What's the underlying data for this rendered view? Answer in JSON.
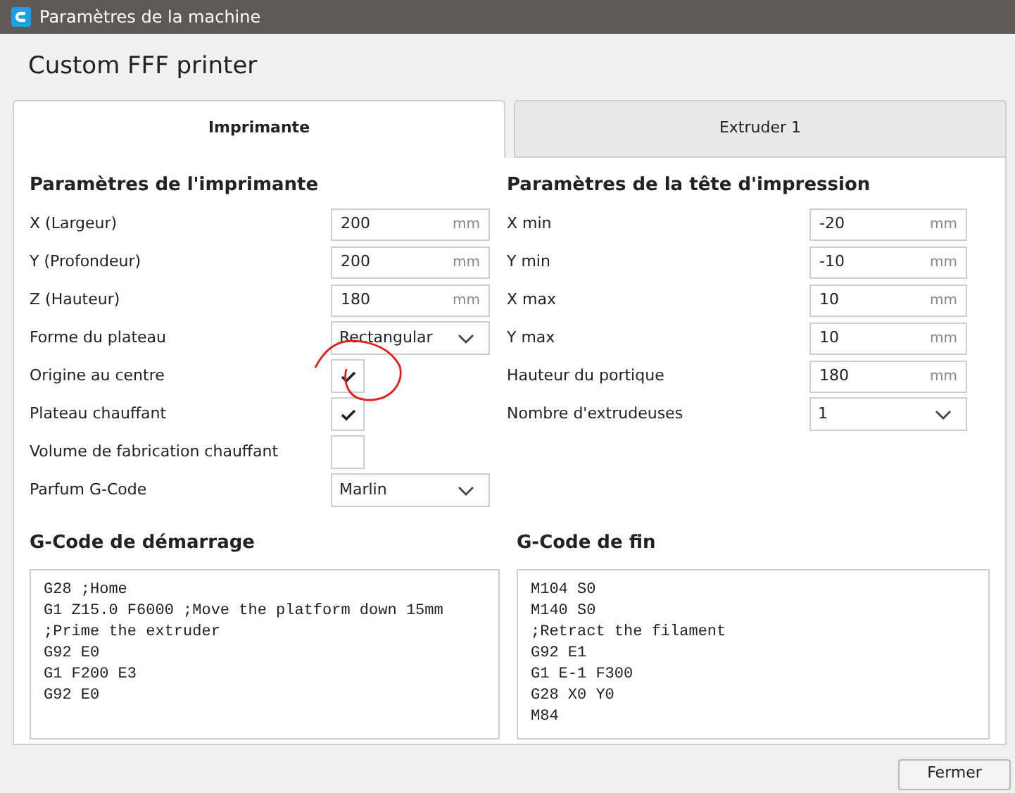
{
  "window": {
    "title": "Paramètres de la machine"
  },
  "header": "Custom FFF printer",
  "tabs": [
    {
      "label": "Imprimante",
      "selected": true
    },
    {
      "label": "Extruder 1",
      "selected": false
    }
  ],
  "printer_settings": {
    "title": "Paramètres de l'imprimante",
    "rows": [
      {
        "kind": "number",
        "label": "X (Largeur)",
        "value": "200",
        "unit": "mm"
      },
      {
        "kind": "number",
        "label": "Y (Profondeur)",
        "value": "200",
        "unit": "mm"
      },
      {
        "kind": "number",
        "label": "Z (Hauteur)",
        "value": "180",
        "unit": "mm"
      },
      {
        "kind": "dropdown",
        "label": "Forme du plateau",
        "value": "Rectangular"
      },
      {
        "kind": "checkbox",
        "label": "Origine au centre",
        "checked": true,
        "annotated": true
      },
      {
        "kind": "checkbox",
        "label": "Plateau chauffant",
        "checked": true
      },
      {
        "kind": "checkbox",
        "label": "Volume de fabrication chauffant",
        "checked": false
      },
      {
        "kind": "dropdown",
        "label": "Parfum G-Code",
        "value": "Marlin"
      }
    ]
  },
  "printhead_settings": {
    "title": "Paramètres de la tête d'impression",
    "rows": [
      {
        "kind": "number",
        "label": "X min",
        "value": "-20",
        "unit": "mm"
      },
      {
        "kind": "number",
        "label": "Y min",
        "value": "-10",
        "unit": "mm"
      },
      {
        "kind": "number",
        "label": "X max",
        "value": "10",
        "unit": "mm"
      },
      {
        "kind": "number",
        "label": "Y max",
        "value": "10",
        "unit": "mm"
      },
      {
        "kind": "number",
        "label": "Hauteur du portique",
        "value": "180",
        "unit": "mm"
      },
      {
        "kind": "dropdown",
        "label": "Nombre d'extrudeuses",
        "value": "1"
      }
    ]
  },
  "start_gcode": {
    "title": "G-Code de démarrage",
    "lines": [
      "G28 ;Home",
      "G1 Z15.0 F6000 ;Move the platform down 15mm",
      ";Prime the extruder",
      "G92 E0",
      "G1 F200 E3",
      "G92 E0"
    ]
  },
  "end_gcode": {
    "title": "G-Code de fin",
    "lines": [
      "M104 S0",
      "M140 S0",
      ";Retract the filament",
      "G92 E1",
      "G1 E-1 F300",
      "G28 X0 Y0",
      "M84"
    ]
  },
  "buttons": [
    "Fermer"
  ]
}
